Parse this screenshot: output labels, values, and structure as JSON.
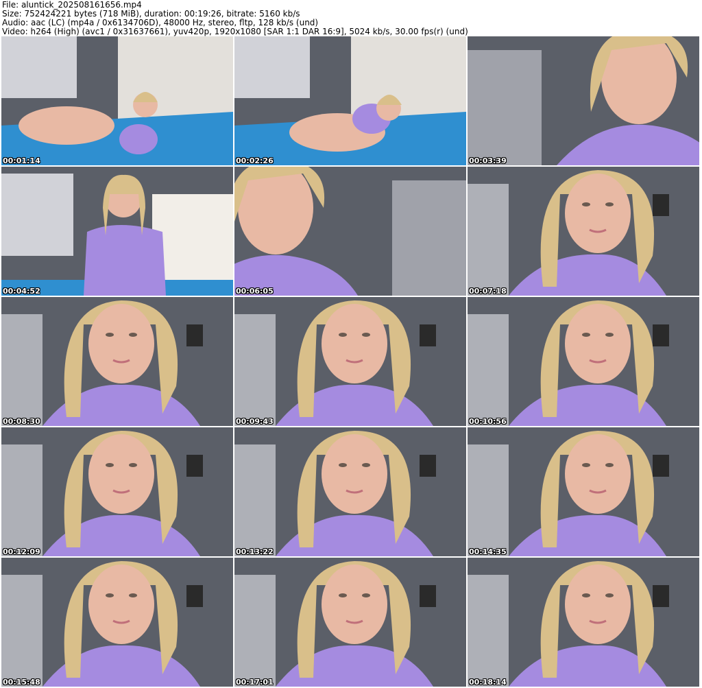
{
  "header": {
    "file_line": "File: aluntick_202508161656.mp4",
    "size_line": "Size: 752424221 bytes (718 MiB), duration: 00:19:26, bitrate: 5160 kb/s",
    "audio_line": "Audio: aac (LC) (mp4a / 0x6134706D), 48000 Hz, stereo, fltp, 128 kb/s (und)",
    "video_line": "Video: h264 (High) (avc1 / 0x31637661), yuv420p, 1920x1080 [SAR 1:1 DAR 16:9], 5024 kb/s, 30.00 fps(r) (und)"
  },
  "thumbnails": [
    {
      "timestamp": "00:01:14",
      "scene": "floor"
    },
    {
      "timestamp": "00:02:26",
      "scene": "floor"
    },
    {
      "timestamp": "00:03:39",
      "scene": "closeup"
    },
    {
      "timestamp": "00:04:52",
      "scene": "bed"
    },
    {
      "timestamp": "00:06:05",
      "scene": "closeup"
    },
    {
      "timestamp": "00:07:18",
      "scene": "portrait"
    },
    {
      "timestamp": "00:08:30",
      "scene": "portrait"
    },
    {
      "timestamp": "00:09:43",
      "scene": "portrait"
    },
    {
      "timestamp": "00:10:56",
      "scene": "portrait"
    },
    {
      "timestamp": "00:12:09",
      "scene": "portrait"
    },
    {
      "timestamp": "00:13:22",
      "scene": "portrait"
    },
    {
      "timestamp": "00:14:35",
      "scene": "portrait"
    },
    {
      "timestamp": "00:15:48",
      "scene": "portrait"
    },
    {
      "timestamp": "00:17:01",
      "scene": "portrait"
    },
    {
      "timestamp": "00:18:14",
      "scene": "portrait"
    }
  ],
  "colors": {
    "wall": "#5b5f68",
    "shirt": "#a58be0",
    "hair": "#d9bf8a",
    "skin": "#e8b9a4",
    "mat": "#2f8fd0",
    "shelf": "#e6e6ec",
    "bedding": "#f2eee8"
  }
}
